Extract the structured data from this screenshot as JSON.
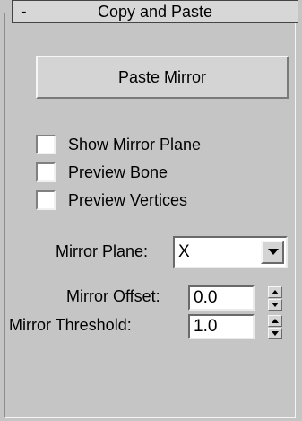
{
  "rollout": {
    "collapse_symbol": "-",
    "title": "Copy and Paste"
  },
  "buttons": {
    "paste_mirror": "Paste Mirror"
  },
  "checkboxes": [
    {
      "label": "Show Mirror Plane",
      "checked": false
    },
    {
      "label": "Preview Bone",
      "checked": false
    },
    {
      "label": "Preview Vertices",
      "checked": false
    }
  ],
  "mirror_plane": {
    "label": "Mirror Plane:",
    "value": "X"
  },
  "mirror_offset": {
    "label": "Mirror Offset:",
    "value": "0.0"
  },
  "mirror_threshold": {
    "label": "Mirror Threshold:",
    "value": "1.0"
  },
  "icons": {
    "dropdown_arrow": "chevron-down-icon",
    "spinner_up": "spinner-up-icon",
    "spinner_down": "spinner-down-icon"
  }
}
